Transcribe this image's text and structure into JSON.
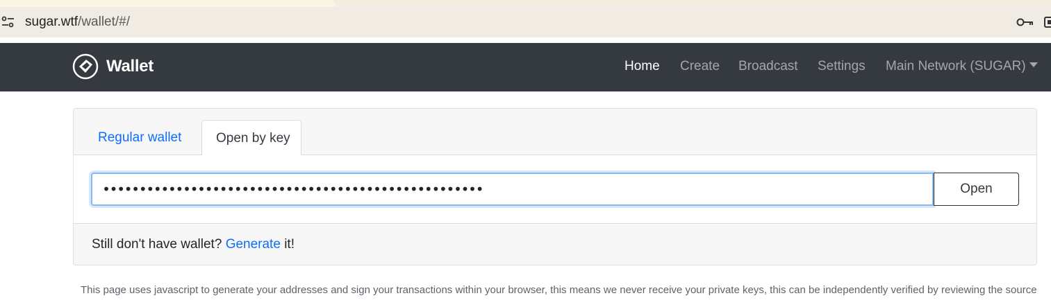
{
  "browser": {
    "url_domain": "sugar.wtf",
    "url_path": "/wallet/#/"
  },
  "navbar": {
    "brand": "Wallet",
    "links": [
      {
        "label": "Home",
        "active": true
      },
      {
        "label": "Create",
        "active": false
      },
      {
        "label": "Broadcast",
        "active": false
      },
      {
        "label": "Settings",
        "active": false
      }
    ],
    "network_dropdown": "Main Network (SUGAR)"
  },
  "card": {
    "tabs": [
      {
        "label": "Regular wallet",
        "active": false
      },
      {
        "label": "Open by key",
        "active": true
      }
    ],
    "key_input_value": "••••••••••••••••••••••••••••••••••••••••••••••••••••",
    "open_button": "Open",
    "footer_prefix": "Still don't have wallet?",
    "footer_link": "Generate",
    "footer_suffix": "it!"
  },
  "notice": "This page uses javascript to generate your addresses and sign your transactions within your browser, this means we never receive your private keys, this can be independently verified by reviewing the source",
  "colors": {
    "navbar_bg": "#343a40",
    "link_blue": "#0d6efd",
    "focus_ring": "#8ab8f0"
  },
  "icons": [
    "site-info-icon",
    "key-icon",
    "extension-icon",
    "wallet-logo-icon",
    "caret-down-icon"
  ]
}
